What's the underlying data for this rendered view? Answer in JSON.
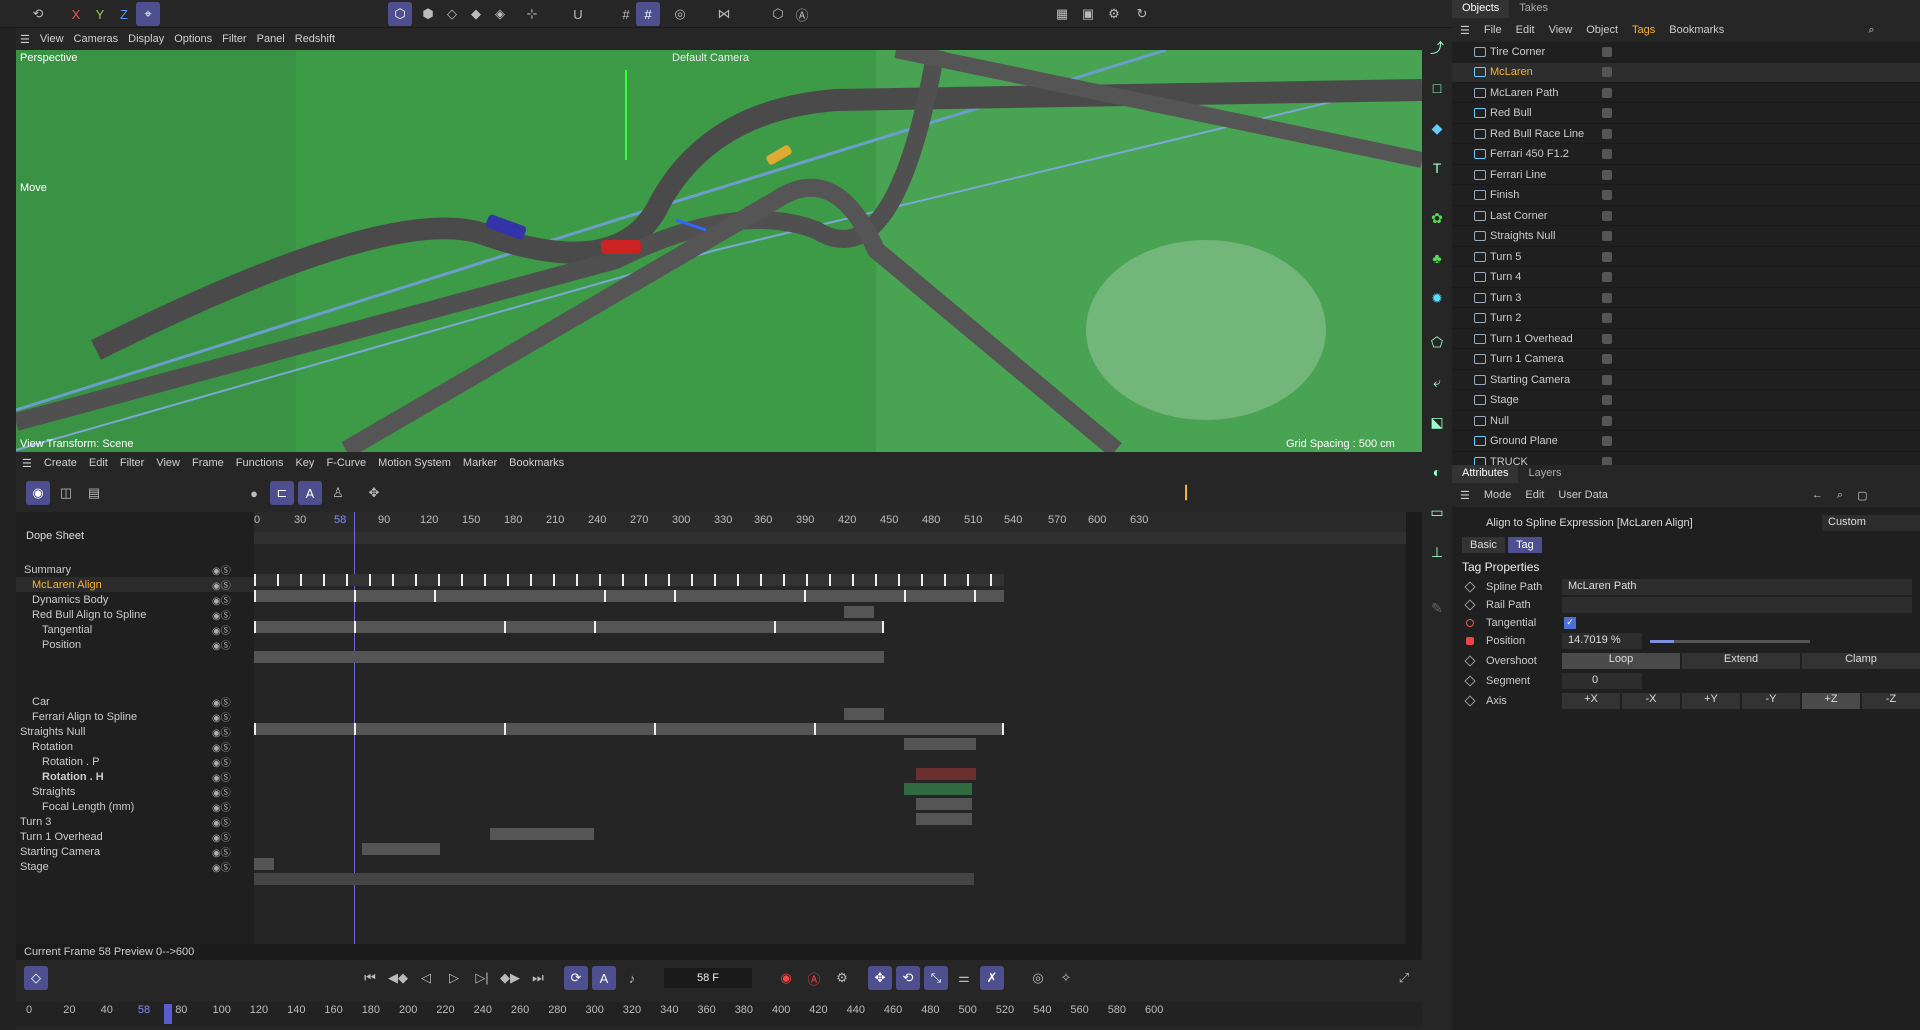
{
  "toolbar": {
    "x_label": "X",
    "y_label": "Y",
    "z_label": "Z"
  },
  "viewport": {
    "menu": [
      "View",
      "Cameras",
      "Display",
      "Options",
      "Filter",
      "Panel",
      "Redshift"
    ],
    "name": "Perspective",
    "camera": "Default Camera",
    "tool": "Move",
    "transform": "View Transform: Scene",
    "grid": "Grid Spacing : 500 cm"
  },
  "objects": {
    "tabs": [
      "Objects",
      "Takes"
    ],
    "menu": [
      "File",
      "Edit",
      "View",
      "Object",
      "Tags",
      "Bookmarks"
    ],
    "items": [
      "Tire Corner",
      "McLaren",
      "McLaren Path",
      "Red Bull",
      "Red Bull Race Line",
      "Ferrari 450 F1.2",
      "Ferrari Line",
      "Finish",
      "Last Corner",
      "Straights Null",
      "Turn 5",
      "Turn 4",
      "Turn 3",
      "Turn 2",
      "Turn 1 Overhead",
      "Turn 1 Camera",
      "Starting Camera",
      "Stage",
      "Null",
      "Ground Plane",
      "TRUCK"
    ]
  },
  "attributes": {
    "tabs": [
      "Attributes",
      "Layers"
    ],
    "menu": [
      "Mode",
      "Edit",
      "User Data"
    ],
    "title": "Align to Spline Expression [McLaren Align]",
    "preset": "Custom",
    "subtabs": [
      "Basic",
      "Tag"
    ],
    "section": "Tag Properties",
    "spline_path_label": "Spline Path",
    "spline_path": "McLaren Path",
    "rail_path_label": "Rail Path",
    "tangential_label": "Tangential",
    "position_label": "Position",
    "position": "14.7019 %",
    "position_fraction": 0.147,
    "overshoot_label": "Overshoot",
    "overshoot": [
      "Loop",
      "Extend",
      "Clamp"
    ],
    "segment_label": "Segment",
    "segment": "0",
    "axis_label": "Axis",
    "axis": [
      "+X",
      "-X",
      "+Y",
      "-Y",
      "+Z",
      "-Z"
    ]
  },
  "timeline": {
    "menu": [
      "Create",
      "Edit",
      "Filter",
      "View",
      "Frame",
      "Functions",
      "Key",
      "F-Curve",
      "Motion System",
      "Marker",
      "Bookmarks"
    ],
    "mode": "Dope Sheet",
    "ruler": [
      "0",
      "30",
      "58",
      "90",
      "120",
      "150",
      "180",
      "210",
      "240",
      "270",
      "300",
      "330",
      "360",
      "390",
      "420",
      "450",
      "480",
      "510",
      "540",
      "570",
      "600",
      "630"
    ],
    "tracks": [
      "Summary",
      "McLaren Align",
      "Dynamics Body",
      "Red Bull Align to Spline",
      "Tangential",
      "Position",
      "Car",
      "Ferrari Align to Spline",
      "Straights Null",
      "Rotation",
      "Rotation . P",
      "Rotation . H",
      "Straights",
      "Focal Length (mm)",
      "Turn 3",
      "Turn 1 Overhead",
      "Starting Camera",
      "Stage"
    ],
    "status": "Current Frame  58  Preview  0-->600",
    "frame": "58 F",
    "bottom_ruler": [
      "0",
      "20",
      "40",
      "58",
      "80",
      "100",
      "120",
      "140",
      "160",
      "180",
      "200",
      "220",
      "240",
      "260",
      "280",
      "300",
      "320",
      "340",
      "360",
      "380",
      "400",
      "420",
      "440",
      "460",
      "480",
      "500",
      "520",
      "540",
      "560",
      "580",
      "600"
    ]
  }
}
